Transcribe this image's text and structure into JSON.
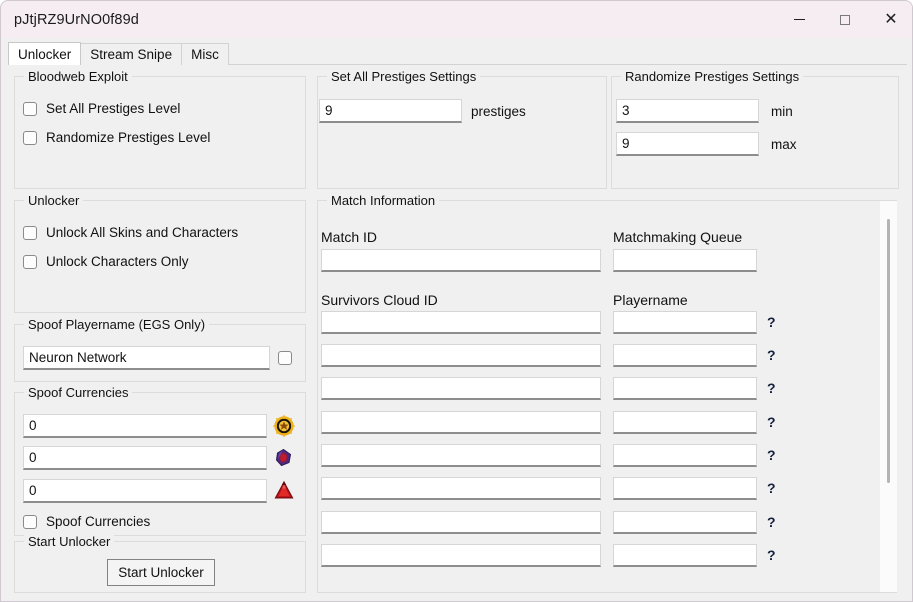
{
  "window": {
    "title": "pJtjRZ9UrNO0f89d",
    "controls": {
      "minimize": "minimize-icon",
      "maximize": "maximize-icon",
      "close": "close-icon"
    }
  },
  "tabs": [
    {
      "label": "Unlocker",
      "active": true
    },
    {
      "label": "Stream Snipe",
      "active": false
    },
    {
      "label": "Misc",
      "active": false
    }
  ],
  "bloodweb": {
    "legend": "Bloodweb Exploit",
    "checkboxes": [
      {
        "label": "Set All Prestiges Level",
        "checked": false
      },
      {
        "label": "Randomize Prestiges Level",
        "checked": false
      }
    ]
  },
  "set_all_prestiges": {
    "legend": "Set All Prestiges Settings",
    "value": "9",
    "unit_label": "prestiges"
  },
  "randomize_prestiges": {
    "legend": "Randomize Prestiges Settings",
    "min_value": "3",
    "min_label": "min",
    "max_value": "9",
    "max_label": "max"
  },
  "unlocker": {
    "legend": "Unlocker",
    "checkboxes": [
      {
        "label": "Unlock All Skins and Characters",
        "checked": false
      },
      {
        "label": "Unlock Characters Only",
        "checked": false
      }
    ]
  },
  "spoof_playername": {
    "legend": "Spoof Playername (EGS Only)",
    "value": "Neuron Network",
    "enabled": false
  },
  "spoof_currencies": {
    "legend": "Spoof Currencies",
    "rows": [
      {
        "value": "0",
        "icon": "bloodpoints-icon"
      },
      {
        "value": "0",
        "icon": "auric-cells-icon"
      },
      {
        "value": "0",
        "icon": "iridescent-shards-icon"
      }
    ],
    "toggle_label": "Spoof Currencies",
    "toggle_checked": false
  },
  "start_unlocker": {
    "legend": "Start Unlocker",
    "button_label": "Start Unlocker"
  },
  "match_information": {
    "legend": "Match Information",
    "match_id_label": "Match ID",
    "match_id_value": "",
    "matchmaking_queue_label": "Matchmaking Queue",
    "matchmaking_queue_value": "",
    "survivors_cloud_id_label": "Survivors Cloud ID",
    "playername_label": "Playername",
    "help_glyph": "?",
    "rows": [
      {
        "cloud_id": "",
        "playername": ""
      },
      {
        "cloud_id": "",
        "playername": ""
      },
      {
        "cloud_id": "",
        "playername": ""
      },
      {
        "cloud_id": "",
        "playername": ""
      },
      {
        "cloud_id": "",
        "playername": ""
      },
      {
        "cloud_id": "",
        "playername": ""
      },
      {
        "cloud_id": "",
        "playername": ""
      },
      {
        "cloud_id": "",
        "playername": ""
      }
    ]
  },
  "colors": {
    "titlebar": "#f6edf3",
    "background": "#f0f0f0",
    "field_bg": "#ffffff",
    "border": "#dcdcdc",
    "accent_gold": "#e8a21a",
    "accent_purple": "#5b2d8e",
    "accent_red": "#b8161c"
  }
}
